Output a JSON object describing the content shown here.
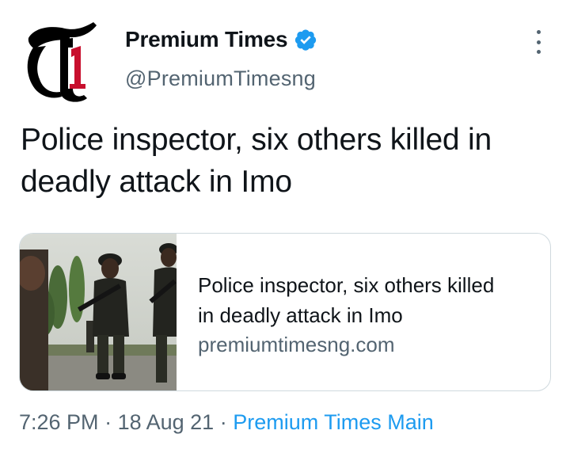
{
  "author": {
    "display_name": "Premium Times",
    "handle": "@PremiumTimesng",
    "verified": true,
    "avatar_icon": "premium-times-logo-icon"
  },
  "tweet": {
    "text": "Police inspector, six others killed in deadly attack in Imo"
  },
  "card": {
    "title": "Police inspector, six others killed in deadly attack in Imo",
    "domain": "premiumtimesng.com",
    "image": "photo-police-officers"
  },
  "meta": {
    "time": "7:26 PM",
    "sep1": " · ",
    "date": "18 Aug 21",
    "sep2": " · ",
    "source": "Premium Times Main"
  },
  "colors": {
    "text": "#0f1419",
    "secondary": "#536471",
    "link": "#1d9bf0",
    "border": "#cfd9de",
    "logo_red": "#c8102e"
  }
}
